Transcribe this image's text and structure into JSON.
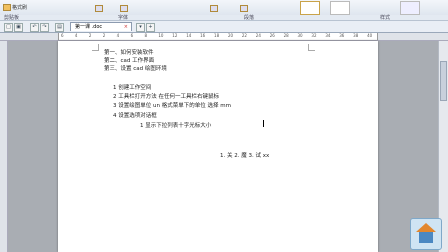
{
  "ribbon": {
    "format_painter": "格式刷",
    "clipboard_group": "剪贴板",
    "font_group": "字体",
    "paragraph_group": "段落",
    "styles_group": "样式"
  },
  "tabbar": {
    "doc_tab_label": "第一课 .doc"
  },
  "ruler": {
    "numbers": [
      "6",
      "4",
      "2",
      "2",
      "4",
      "6",
      "8",
      "10",
      "12",
      "14",
      "16",
      "18",
      "20",
      "22",
      "24",
      "26",
      "28",
      "30",
      "32",
      "34",
      "36",
      "38",
      "40"
    ]
  },
  "document": {
    "lines": [
      "第一、如何安装软件",
      "第二、cad 工作界面",
      "第三、设置 cad 绘图环境",
      "1 创建工作空间",
      "2 工具栏打开方法 在任何一工具栏右键鼠标",
      "3 设置绘图单位 un 格式菜单下的单位 选择 mm",
      "4 设置选项对话框",
      "1 显示下拉列表十字光标大小",
      "1. 关 2. 魔 3. 试 xx"
    ]
  }
}
